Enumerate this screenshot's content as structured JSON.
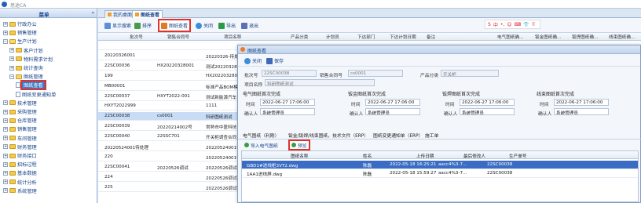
{
  "window": {
    "title": "思途CA"
  },
  "sidebar": {
    "title": "菜单",
    "collapse_glyph": "«",
    "items": [
      {
        "label": "行政办公",
        "level": 0,
        "expanded": false
      },
      {
        "label": "销售管理",
        "level": 0,
        "expanded": false
      },
      {
        "label": "生产计划",
        "level": 0,
        "expanded": true
      },
      {
        "label": "客户计划",
        "level": 1,
        "expanded": false
      },
      {
        "label": "物料需求计划",
        "level": 1,
        "expanded": false
      },
      {
        "label": "统计查询",
        "level": 1,
        "expanded": false
      },
      {
        "label": "图纸管理",
        "level": 1,
        "expanded": true
      },
      {
        "label": "图纸查看",
        "level": 2,
        "selected": true
      },
      {
        "label": "图纸变更通知单",
        "level": 2
      },
      {
        "label": "技术管理",
        "level": 0,
        "expanded": false
      },
      {
        "label": "采购管理",
        "level": 0,
        "expanded": false
      },
      {
        "label": "仓库管理",
        "level": 0,
        "expanded": false
      },
      {
        "label": "销售管理",
        "level": 0,
        "expanded": false
      },
      {
        "label": "车间管理",
        "level": 0,
        "expanded": false
      },
      {
        "label": "财务管理",
        "level": 0,
        "expanded": false
      },
      {
        "label": "财务接口",
        "level": 0,
        "expanded": false
      },
      {
        "label": "招标过程",
        "level": 0,
        "expanded": false
      },
      {
        "label": "基本数据",
        "level": 0,
        "expanded": false
      },
      {
        "label": "统计分析",
        "level": 0,
        "expanded": false
      },
      {
        "label": "系统管理",
        "level": 0,
        "expanded": false
      }
    ]
  },
  "tabs": [
    {
      "label": "我的桌面",
      "active": false
    },
    {
      "label": "图纸查看",
      "active": true
    }
  ],
  "toolbar": {
    "show_search": "显示搜索",
    "sort": "排序",
    "view_drawing": "图纸查看",
    "close": "关闭",
    "export": "导出",
    "exit": "退出"
  },
  "ime": {
    "items": [
      "S",
      "中",
      "•,",
      "☺",
      "⌨",
      "👕",
      "⠿"
    ]
  },
  "grid": {
    "columns": [
      "批次号",
      "销售合同号",
      "项目名称",
      "产品分类",
      "计划员",
      "下达部门",
      "下达计划日期",
      "备注",
      "电气图纸确...",
      "钣金图纸确...",
      "钣焊图纸确...",
      "线束图纸确..."
    ],
    "rows": [
      {
        "batch": "",
        "contract": "",
        "project": ""
      },
      {
        "batch": "20220326001",
        "contract": "",
        "project": "20220326-待处理"
      },
      {
        "batch": "22SC00036",
        "contract": "HX20220328001",
        "project": "测试20220328001"
      },
      {
        "batch": "199",
        "contract": "",
        "project": "HX20220328001"
      },
      {
        "batch": "MB00001",
        "contract": "",
        "project": "标准产品BOM模"
      },
      {
        "batch": "22SC00037",
        "contract": "HXYT2022-001",
        "project": "测试新能源汽车"
      },
      {
        "batch": "HXYT2022999",
        "contract": "",
        "project": "1111"
      },
      {
        "batch": "22SC00038",
        "contract": "cs0001",
        "project": "科研图纸测试"
      },
      {
        "batch": "22SC00039",
        "contract": "20220214002号",
        "project": "常熟市中盈科技"
      },
      {
        "batch": "22SC00040",
        "contract": "22SSC701",
        "project": "开关柜调查合同"
      },
      {
        "batch": "20220524001待处理",
        "contract": "",
        "project": "20220524001待处理"
      },
      {
        "batch": "220",
        "contract": "",
        "project": "20220524001待处理"
      },
      {
        "batch": "22SC00041",
        "contract": "20220526调试",
        "project": "20220526调试"
      },
      {
        "batch": "224",
        "contract": "",
        "project": "20220526调试"
      },
      {
        "batch": "225",
        "contract": "",
        "project": "20220526调试"
      }
    ]
  },
  "dialog": {
    "title": "图纸查看",
    "toolbar": {
      "close": "关闭",
      "save": "保存"
    },
    "batch_label": "批次号",
    "batch_value": "22SC00038",
    "contract_label": "销售合同号",
    "contract_value": "cs0001",
    "category_label": "产品分类",
    "category_value": "开关柜",
    "project_label": "项目名称",
    "project_value": "科研图纸测试",
    "confirm_groups": [
      {
        "title": "电气图纸首次完成",
        "time_label": "时间",
        "time_value": "2022-06-27 17:06:00",
        "person_label": "确认人",
        "person_value": "系统管理员"
      },
      {
        "title": "钣金图纸首次完成",
        "time_label": "时间",
        "time_value": "2022-06-27 17:06:00",
        "person_label": "确认人",
        "person_value": "系统管理员"
      },
      {
        "title": "钣焊图纸首次完成",
        "time_label": "时间",
        "time_value": "2022-06-27 17:06:00",
        "person_label": "确认人",
        "person_value": "系统管理员"
      },
      {
        "title": "线束图纸首次完成",
        "time_label": "时间",
        "time_value": "2022-06-27 17:06:00",
        "person_label": "确认人",
        "person_value": "系统管理员"
      }
    ],
    "sub_tabs": [
      "电气图纸（利刚）",
      "钣金/钣焊/线束图纸，技术文件（ERP）",
      "图纸变更通知单（ERP）",
      "施工单"
    ],
    "sub_toolbar": {
      "import": "导入电气图纸",
      "preview": "预览"
    },
    "files": {
      "columns": [
        "图纸名称",
        "姓名",
        "上传日期",
        "最后修改人",
        "生产单号"
      ],
      "rows": [
        {
          "name": "GBD1#进线柜3VT2.dwg",
          "person": "陈磊",
          "date": "2022-05-18 16:25:21",
          "modifier": "aacc4%3-7...",
          "order": "22SC00038",
          "selected": true
        },
        {
          "name": "1AA1进线屏.dwg",
          "person": "陈磊",
          "date": "2022-05-18 15:59:27",
          "modifier": "aacc4%3-7...",
          "order": "22SC00038",
          "selected": false
        }
      ]
    }
  },
  "colors": {
    "accent": "#15428b",
    "highlight": "#e0312b",
    "selection": "#3b6cc3"
  }
}
